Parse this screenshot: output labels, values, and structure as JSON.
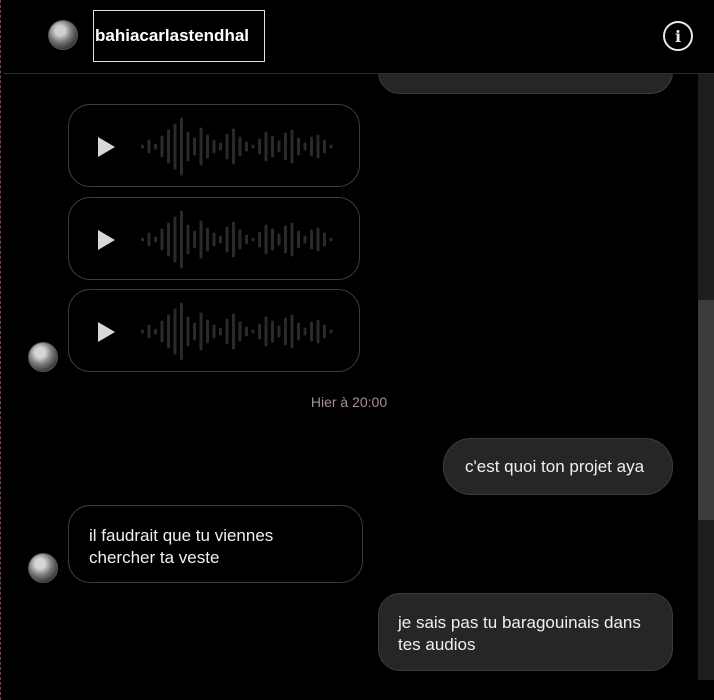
{
  "header": {
    "username": "bahiacarlastendhal",
    "info_icon": "info-icon",
    "info_glyph": "i"
  },
  "messages": {
    "audio_count": 3,
    "timestamp": "Hier à 20:00",
    "outgoing_1": "c'est quoi ton projet aya",
    "incoming_1_line1": "il faudrait que tu viennes",
    "incoming_1_line2": "chercher ta veste",
    "outgoing_2_line1": "je sais pas tu baragouinais dans",
    "outgoing_2_line2": "tes audios"
  },
  "colors": {
    "background": "#000000",
    "outgoing_bubble": "#262626",
    "bubble_border": "#3e3e3e",
    "timestamp_text": "#a49090",
    "waveform": "#2a2a2a"
  }
}
